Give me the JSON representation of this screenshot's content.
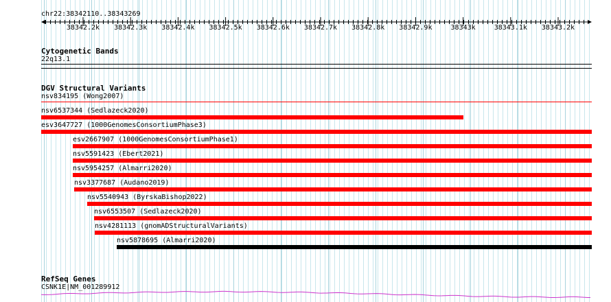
{
  "ruler": {
    "location": "chr22:38342110..38343269",
    "ticks": [
      "38342.2k",
      "38342.3k",
      "38342.4k",
      "38342.5k",
      "38342.6k",
      "38342.7k",
      "38342.8k",
      "38342.9k",
      "38343k",
      "38343.1k",
      "38343.2k"
    ]
  },
  "cytobands": {
    "title": "Cytogenetic Bands",
    "band": "22q13.1"
  },
  "dgv": {
    "title": "DGV Structural Variants",
    "first_label": "nsv834195 (Wong2007)",
    "features": [
      {
        "label": "nsv6537344 (Sedlazeck2020)",
        "color": "#ff0000"
      },
      {
        "label": "esv3647727 (1000GenomesConsortiumPhase3)",
        "color": "#ff0000"
      },
      {
        "label": "esv2667907 (1000GenomesConsortiumPhase1)",
        "color": "#ff0000"
      },
      {
        "label": "nsv5591423 (Ebert2021)",
        "color": "#ff0000"
      },
      {
        "label": "nsv5954257 (Almarri2020)",
        "color": "#ff0000"
      },
      {
        "label": "nsv3377687 (Audano2019)",
        "color": "#ff0000"
      },
      {
        "label": "nsv5540943 (ByrskaBishop2022)",
        "color": "#ff0000"
      },
      {
        "label": "nsv6553507 (Sedlazeck2020)",
        "color": "#ff0000"
      },
      {
        "label": "nsv4281113 (gnomADStructuralVariants)",
        "color": "#ff0000"
      },
      {
        "label": "nsv5878695 (Almarri2020)",
        "color": "#000000"
      }
    ]
  },
  "refseq": {
    "title": "RefSeq Genes",
    "gene": "CSNK1E|NM_001289912",
    "color": "#cc33cc"
  }
}
